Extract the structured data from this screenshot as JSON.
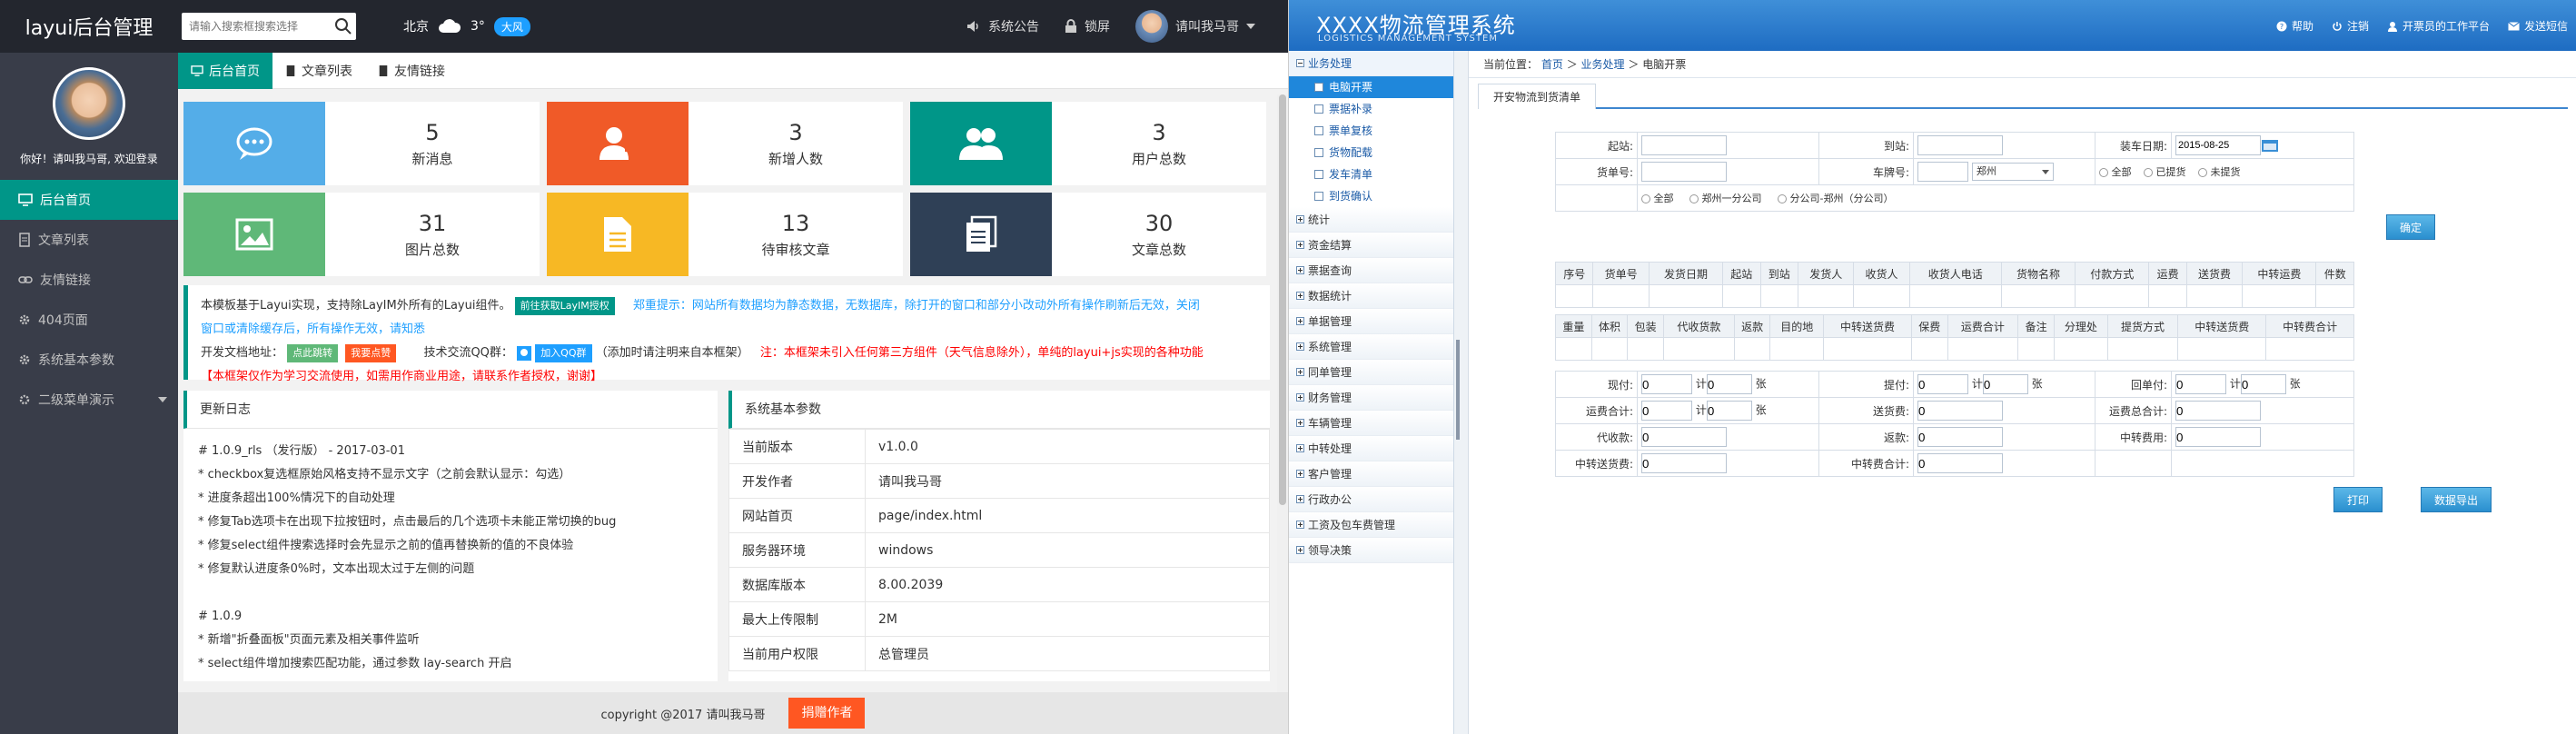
{
  "left": {
    "logo": "layui后台管理",
    "search_placeholder": "请输入搜索框搜索选择",
    "weather": {
      "city": "北京",
      "temp": "3°",
      "wind": "大风"
    },
    "top_links": [
      {
        "label": "系统公告"
      },
      {
        "label": "锁屏"
      }
    ],
    "user": "请叫我马哥",
    "welcome": "你好！请叫我马哥, 欢迎登录",
    "menu": [
      {
        "label": "后台首页"
      },
      {
        "label": "文章列表"
      },
      {
        "label": "友情链接"
      },
      {
        "label": "404页面"
      },
      {
        "label": "系统基本参数"
      },
      {
        "label": "二级菜单演示"
      }
    ],
    "tabs": [
      {
        "label": "后台首页"
      },
      {
        "label": "文章列表"
      },
      {
        "label": "友情链接"
      }
    ],
    "cards": [
      {
        "num": "5",
        "label": "新消息",
        "color": "#54ade8"
      },
      {
        "num": "3",
        "label": "新增人数",
        "color": "#f05a28"
      },
      {
        "num": "3",
        "label": "用户总数",
        "color": "#009688"
      },
      {
        "num": "31",
        "label": "图片总数",
        "color": "#5fb878"
      },
      {
        "num": "13",
        "label": "待审核文章",
        "color": "#f7b824"
      },
      {
        "num": "30",
        "label": "文章总数",
        "color": "#2f4056"
      }
    ],
    "notice": {
      "l1a": "本模板基于Layui实现，支持除LayIM外所有的Layui组件。",
      "l1btn": "前往获取LayIM授权",
      "l1b": "郑重提示：网站所有数据均为静态数据，无数据库，除打开的窗口和部分小改动外所有操作刷新后无效，关闭",
      "l2": "窗口或清除缓存后，所有操作无效，请知悉",
      "l3a": "开发文档地址：",
      "l3btn1": "点此跳转",
      "l3btn2": "我要点赞",
      "l3b": "技术交流QQ群：",
      "l3btn3": "加入QQ群",
      "l3c": "（添加时请注明来自本框架）",
      "l3d": "注：本框架未引入任何第三方组件（天气信息除外），单纯的layui+js实现的各种功能",
      "l4": "【本框架仅作为学习交流使用，如需用作商业用途，请联系作者授权，谢谢】"
    },
    "changelog": {
      "title": "更新日志",
      "lines": [
        "# 1.0.9_rls （发行版） - 2017-03-01",
        "* checkbox复选框原始风格支持不显示文字（之前会默认显示：勾选）",
        "* 进度条超出100%情况下的自动处理",
        "* 修复Tab选项卡在出现下拉按钮时，点击最后的几个选项卡未能正常切换的bug",
        "* 修复select组件搜索选择时会先显示之前的值再替换新的值的不良体验",
        "* 修复默认进度条0%时，文本出现太过于左侧的问题",
        "",
        "# 1.0.9",
        "* 新增\"折叠面板\"页面元素及相关事件监听",
        "* select组件增加搜索匹配功能，通过参数 lay-search 开启"
      ]
    },
    "sysparams": {
      "title": "系统基本参数",
      "rows": [
        {
          "k": "当前版本",
          "v": "v1.0.0"
        },
        {
          "k": "开发作者",
          "v": "请叫我马哥"
        },
        {
          "k": "网站首页",
          "v": "page/index.html"
        },
        {
          "k": "服务器环境",
          "v": "windows"
        },
        {
          "k": "数据库版本",
          "v": "8.00.2039"
        },
        {
          "k": "最大上传限制",
          "v": "2M"
        },
        {
          "k": "当前用户权限",
          "v": "总管理员"
        }
      ]
    },
    "footer": {
      "copyright": "copyright @2017 请叫我马哥",
      "donate": "捐赠作者"
    }
  },
  "right": {
    "logo": "XXXX物流管理系统",
    "logo_sub": "LOGISTICS MANAGEMENT SYSTEM",
    "top_links": [
      {
        "label": "帮助"
      },
      {
        "label": "注销"
      },
      {
        "label": "开票员的工作平台"
      },
      {
        "label": "发送短信"
      }
    ],
    "menu_open": "业务处理",
    "submenu": [
      {
        "label": "电脑开票"
      },
      {
        "label": "票据补录"
      },
      {
        "label": "票单复核"
      },
      {
        "label": "货物配载"
      },
      {
        "label": "发车清单"
      },
      {
        "label": "到货确认"
      }
    ],
    "groups": [
      {
        "label": "统计"
      },
      {
        "label": "资金结算"
      },
      {
        "label": "票据查询"
      },
      {
        "label": "数据统计"
      },
      {
        "label": "单据管理"
      },
      {
        "label": "系统管理"
      },
      {
        "label": "同单管理"
      },
      {
        "label": "财务管理"
      },
      {
        "label": "车辆管理"
      },
      {
        "label": "中转处理"
      },
      {
        "label": "客户管理"
      },
      {
        "label": "行政办公"
      },
      {
        "label": "工资及包车费管理"
      },
      {
        "label": "领导决策"
      }
    ],
    "crumb": {
      "prefix": "当前位置：",
      "home": "首页",
      "sec": "业务处理",
      "cur": "电脑开票"
    },
    "tab": "开安物流到货清单",
    "form": {
      "start": "起站:",
      "end": "到站:",
      "date_label": "装车日期:",
      "date": "2015-08-25",
      "goods_no": "货单号:",
      "plate": "车牌号:",
      "city": "郑州",
      "r_all": "全部",
      "r_picked": "已提货",
      "r_unpicked": "未提货",
      "r2_all": "全部",
      "r2_zz1": "郑州一分公司",
      "r2_zz2": "分公司-郑州（分公司）"
    },
    "confirm": "确定",
    "head1": [
      "序号",
      "货单号",
      "发货日期",
      "起站",
      "到站",
      "发货人",
      "收货人",
      "收货人电话",
      "货物名称",
      "付款方式",
      "运费",
      "送货费",
      "中转运费",
      "件数"
    ],
    "head2": [
      "重量",
      "体积",
      "包装",
      "代收货款",
      "返款",
      "目的地",
      "中转送货费",
      "保费",
      "运费合计",
      "备注",
      "分理处",
      "提货方式",
      "中转送货费",
      "中转费合计"
    ],
    "summary": {
      "xianfu": "现付:",
      "tifu": "提付:",
      "huidan": "回单付:",
      "ji": "计",
      "zhang": "张",
      "yunfei": "运费合计:",
      "songhuo": "送货费:",
      "yunfeizong": "运费总合计:",
      "daishou": "代收款:",
      "fankuan": "返款:",
      "zhongzhuan": "中转费用:",
      "zzsonghuo": "中转送货费:",
      "zzfeiyong": "中转费合计:",
      "zero": "0"
    },
    "print": "打印",
    "export": "数据导出"
  }
}
